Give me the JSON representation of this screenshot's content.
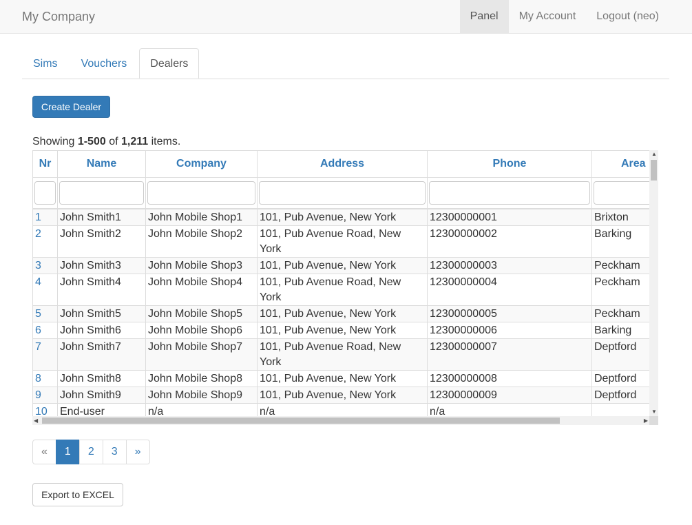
{
  "navbar": {
    "brand": "My Company",
    "items": [
      {
        "label": "Panel",
        "active": true
      },
      {
        "label": "My Account",
        "active": false
      },
      {
        "label": "Logout (neo)",
        "active": false
      }
    ]
  },
  "tabs": [
    {
      "label": "Sims",
      "active": false
    },
    {
      "label": "Vouchers",
      "active": false
    },
    {
      "label": "Dealers",
      "active": true
    }
  ],
  "create_button": "Create Dealer",
  "summary": {
    "prefix": "Showing ",
    "range": "1-500",
    "of": " of ",
    "total": "1,211",
    "suffix": " items."
  },
  "grid": {
    "columns": [
      "Nr",
      "Name",
      "Company",
      "Address",
      "Phone",
      "Area"
    ],
    "rows": [
      {
        "nr": "1",
        "name": "John Smith1",
        "company": "John Mobile Shop1",
        "address": "101, Pub Avenue, New York",
        "phone": "12300000001",
        "area": "Brixton"
      },
      {
        "nr": "2",
        "name": "John Smith2",
        "company": "John Mobile Shop2",
        "address": "101, Pub Avenue Road, New York",
        "phone": "12300000002",
        "area": "Barking"
      },
      {
        "nr": "3",
        "name": "John Smith3",
        "company": "John Mobile Shop3",
        "address": "101, Pub Avenue, New York",
        "phone": "12300000003",
        "area": "Peckham"
      },
      {
        "nr": "4",
        "name": "John Smith4",
        "company": "John Mobile Shop4",
        "address": "101, Pub Avenue Road, New York",
        "phone": "12300000004",
        "area": "Peckham"
      },
      {
        "nr": "5",
        "name": "John Smith5",
        "company": "John Mobile Shop5",
        "address": "101, Pub Avenue, New York",
        "phone": "12300000005",
        "area": "Peckham"
      },
      {
        "nr": "6",
        "name": "John Smith6",
        "company": "John Mobile Shop6",
        "address": "101, Pub Avenue, New York",
        "phone": "12300000006",
        "area": "Barking"
      },
      {
        "nr": "7",
        "name": "John Smith7",
        "company": "John Mobile Shop7",
        "address": "101, Pub Avenue Road, New York",
        "phone": "12300000007",
        "area": "Deptford"
      },
      {
        "nr": "8",
        "name": "John Smith8",
        "company": "John Mobile Shop8",
        "address": "101, Pub Avenue, New York",
        "phone": "12300000008",
        "area": "Deptford"
      },
      {
        "nr": "9",
        "name": "John Smith9",
        "company": "John Mobile Shop9",
        "address": "101, Pub Avenue, New York",
        "phone": "12300000009",
        "area": "Deptford"
      },
      {
        "nr": "10",
        "name": "End-user",
        "company": "n/a",
        "address": "n/a",
        "phone": "n/a",
        "area": ""
      }
    ]
  },
  "pagination": [
    "«",
    "1",
    "2",
    "3",
    "»"
  ],
  "pagination_active": "1",
  "export_button": "Export to EXCEL",
  "colors": {
    "primary": "#337ab7",
    "navbar_bg": "#f8f8f8",
    "border": "#dddddd"
  }
}
